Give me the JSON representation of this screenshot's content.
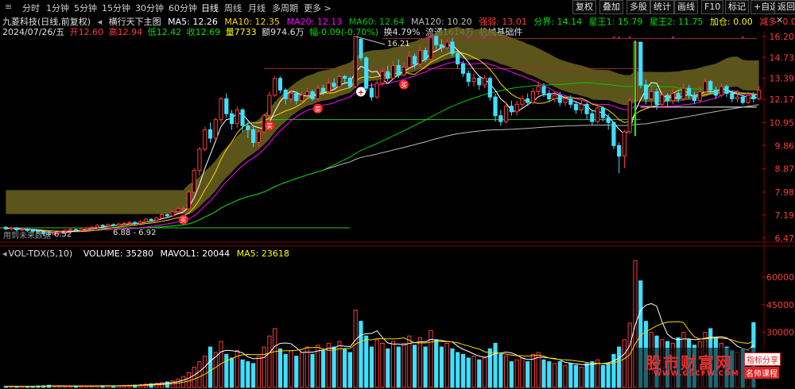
{
  "timeframe_tabs": [
    "分时",
    "1分钟",
    "5分钟",
    "15分钟",
    "30分钟",
    "60分钟",
    "日线",
    "周线",
    "月线",
    "多周期",
    "更多 >"
  ],
  "active_tab": "日线",
  "right_buttons": [
    "复权",
    "叠加",
    "多股",
    "统计",
    "画线",
    "F10",
    "标记",
    "+自选",
    "返回"
  ],
  "title_row": {
    "stock": "九菱科技(日线,前复权)",
    "indicator": "横行天下主图",
    "ma5": "MA5: 12.26",
    "ma10": "MA10: 12.35",
    "ma20": "MA20: 12.13",
    "ma60": "MA60: 12.64",
    "ma120": "MA120: 10.20",
    "qiangruo": "强弱: 13.01",
    "fenjie": "分界: 14.14",
    "wang1": "星王1: 15.79",
    "wang2": "星王2: 11.75",
    "jiacang": "加仓: 0.00",
    "jianduo": "减多: 0.00"
  },
  "info_row": {
    "date": "2024/07/26/五",
    "open": "开12.60",
    "high": "高12.94",
    "low": "低12.42",
    "close": "收12.69",
    "vol": "量7733",
    "amount": "额974.6万",
    "change": "幅-0.09(-0.70%)",
    "turnover": "换4.79%",
    "float": "流通1614万",
    "sector": "机械基础件"
  },
  "annotations": {
    "high_label": "16.21",
    "low_label1": "6.52",
    "low_label2": "6.88 - 6.92",
    "future_text": "用到未来数据"
  },
  "volume_header": {
    "name": "VOL-TDX(5,10)",
    "volume": "VOLUME: 35280",
    "mavol1": "MAVOL1: 20044",
    "ma5": "MA5: 23618"
  },
  "price_axis_labels": [
    "16.20",
    "14.73",
    "13.39",
    "12.17",
    "10.95",
    "9.86",
    "8.87",
    "7.98",
    "7.19",
    "6.47"
  ],
  "volume_axis_labels": [
    "60000",
    "45000",
    "30000"
  ],
  "watermark": {
    "site": "股市财富网",
    "url": "WWW.GSCFW.COM",
    "badge1": "指标分享",
    "badge2": "名师课程"
  },
  "colors": {
    "up": "#ff3a3a",
    "down": "#3ee0ff",
    "ma5": "#ffffff",
    "ma10": "#ffd700",
    "ma20": "#ff00ff",
    "ma60": "#00c800",
    "ma120": "#bbbbbb",
    "band": "#6b6320"
  },
  "chart_data": {
    "type": "candlestick",
    "price_range": [
      6.47,
      16.2
    ],
    "price_scale": "log",
    "dates_shown": [
      "2024/07/26"
    ],
    "candles": [
      [
        6.8,
        6.75,
        6.83,
        6.72
      ],
      [
        6.76,
        6.78,
        6.82,
        6.7
      ],
      [
        6.78,
        6.72,
        6.8,
        6.66
      ],
      [
        6.72,
        6.74,
        6.77,
        6.68
      ],
      [
        6.74,
        6.7,
        6.78,
        6.66
      ],
      [
        6.7,
        6.69,
        6.74,
        6.62
      ],
      [
        6.69,
        6.66,
        6.72,
        6.6
      ],
      [
        6.66,
        6.6,
        6.69,
        6.55
      ],
      [
        6.6,
        6.58,
        6.64,
        6.52
      ],
      [
        6.58,
        6.62,
        6.66,
        6.56
      ],
      [
        6.62,
        6.66,
        6.7,
        6.58
      ],
      [
        6.66,
        6.71,
        6.74,
        6.63
      ],
      [
        6.71,
        6.73,
        6.77,
        6.68
      ],
      [
        6.73,
        6.7,
        6.76,
        6.66
      ],
      [
        6.7,
        6.74,
        6.78,
        6.67
      ],
      [
        6.74,
        6.78,
        6.82,
        6.71
      ],
      [
        6.78,
        6.8,
        6.84,
        6.75
      ],
      [
        6.8,
        6.86,
        6.9,
        6.77
      ],
      [
        6.86,
        6.84,
        6.9,
        6.8
      ],
      [
        6.84,
        6.88,
        6.92,
        6.81
      ],
      [
        6.88,
        6.86,
        6.92,
        6.82
      ],
      [
        6.86,
        6.9,
        6.94,
        6.84
      ],
      [
        6.9,
        6.92,
        6.97,
        6.87
      ],
      [
        6.92,
        6.95,
        7.0,
        6.89
      ],
      [
        6.95,
        6.92,
        6.99,
        6.88
      ],
      [
        6.92,
        6.97,
        7.02,
        6.9
      ],
      [
        6.97,
        7.05,
        7.1,
        6.94
      ],
      [
        7.05,
        7.02,
        7.09,
        6.98
      ],
      [
        7.02,
        7.09,
        7.14,
        7.0
      ],
      [
        7.09,
        7.2,
        7.25,
        7.06
      ],
      [
        7.2,
        7.16,
        7.24,
        7.1
      ],
      [
        7.16,
        7.3,
        7.35,
        7.14
      ],
      [
        7.3,
        7.4,
        7.46,
        7.26
      ],
      [
        7.4,
        7.4,
        7.5,
        7.3
      ],
      [
        7.4,
        7.98,
        8.02,
        7.38
      ],
      [
        7.98,
        8.8,
        8.9,
        7.95
      ],
      [
        8.8,
        9.7,
        9.8,
        8.6
      ],
      [
        9.7,
        10.6,
        10.75,
        9.6
      ],
      [
        10.6,
        10.2,
        10.95,
        10.0
      ],
      [
        10.2,
        11.1,
        11.2,
        10.1
      ],
      [
        11.1,
        12.2,
        12.3,
        10.9
      ],
      [
        12.2,
        11.4,
        12.5,
        11.2
      ],
      [
        11.4,
        10.9,
        11.6,
        10.6
      ],
      [
        10.9,
        11.6,
        11.8,
        10.7
      ],
      [
        11.6,
        10.8,
        11.7,
        10.5
      ],
      [
        10.8,
        10.6,
        11.0,
        10.2
      ],
      [
        10.6,
        10.0,
        10.8,
        9.8
      ],
      [
        10.0,
        10.5,
        10.6,
        9.8
      ],
      [
        10.5,
        11.3,
        11.4,
        10.4
      ],
      [
        11.3,
        12.4,
        12.6,
        11.2
      ],
      [
        12.4,
        13.39,
        13.5,
        12.3
      ],
      [
        13.39,
        12.7,
        13.5,
        12.5
      ],
      [
        12.7,
        12.2,
        12.8,
        11.9
      ],
      [
        12.2,
        12.5,
        12.7,
        12.0
      ],
      [
        12.5,
        12.1,
        12.6,
        11.9
      ],
      [
        12.1,
        12.4,
        12.6,
        11.9
      ],
      [
        12.4,
        12.6,
        12.8,
        12.2
      ],
      [
        12.6,
        12.2,
        12.7,
        12.1
      ],
      [
        12.2,
        12.8,
        13.0,
        12.1
      ],
      [
        12.8,
        12.6,
        13.0,
        12.4
      ],
      [
        12.6,
        13.1,
        13.39,
        12.5
      ],
      [
        13.1,
        12.9,
        13.4,
        12.7
      ],
      [
        12.9,
        13.5,
        13.6,
        12.8
      ],
      [
        13.5,
        13.4,
        13.6,
        13.1
      ],
      [
        13.4,
        12.9,
        13.5,
        12.8
      ],
      [
        12.9,
        16.21,
        16.21,
        12.8
      ],
      [
        16.0,
        14.7,
        16.1,
        14.5
      ],
      [
        14.7,
        12.8,
        14.8,
        12.6
      ],
      [
        12.8,
        12.3,
        13.1,
        12.1
      ],
      [
        12.3,
        13.1,
        13.3,
        12.2
      ],
      [
        13.1,
        13.8,
        14.0,
        12.9
      ],
      [
        13.8,
        13.4,
        14.2,
        13.2
      ],
      [
        13.4,
        14.2,
        14.5,
        13.3
      ],
      [
        14.2,
        13.6,
        14.6,
        13.4
      ],
      [
        13.6,
        14.1,
        14.4,
        13.5
      ],
      [
        14.1,
        14.8,
        15.2,
        14.0
      ],
      [
        14.8,
        14.3,
        15.0,
        14.0
      ],
      [
        14.3,
        15.2,
        15.5,
        14.1
      ],
      [
        15.2,
        14.6,
        15.4,
        14.4
      ],
      [
        14.6,
        16.2,
        16.4,
        14.5
      ],
      [
        16.2,
        15.6,
        16.3,
        15.3
      ],
      [
        15.6,
        15.4,
        16.0,
        15.1
      ],
      [
        15.4,
        15.8,
        16.0,
        15.2
      ],
      [
        15.8,
        15.0,
        16.1,
        14.8
      ],
      [
        15.0,
        14.3,
        15.2,
        14.0
      ],
      [
        14.3,
        13.7,
        14.5,
        13.5
      ],
      [
        13.7,
        13.2,
        13.9,
        12.9
      ],
      [
        13.2,
        13.4,
        13.7,
        12.9
      ],
      [
        13.4,
        13.0,
        13.6,
        12.7
      ],
      [
        13.0,
        13.39,
        13.6,
        12.8
      ],
      [
        13.39,
        12.3,
        13.5,
        12.1
      ],
      [
        12.3,
        11.3,
        12.5,
        11.0
      ],
      [
        11.3,
        11.0,
        11.6,
        10.8
      ],
      [
        11.0,
        11.8,
        12.0,
        10.9
      ],
      [
        11.8,
        11.5,
        12.1,
        11.3
      ],
      [
        11.5,
        11.9,
        12.1,
        11.3
      ],
      [
        11.9,
        12.2,
        12.4,
        11.7
      ],
      [
        12.2,
        12.0,
        12.5,
        11.8
      ],
      [
        12.0,
        12.6,
        12.8,
        11.9
      ],
      [
        12.6,
        12.9,
        13.2,
        12.4
      ],
      [
        12.9,
        12.5,
        13.1,
        12.3
      ],
      [
        12.5,
        12.2,
        12.7,
        12.0
      ],
      [
        12.2,
        12.4,
        12.6,
        12.0
      ],
      [
        12.4,
        12.0,
        12.6,
        11.8
      ],
      [
        12.0,
        12.2,
        12.4,
        11.8
      ],
      [
        12.2,
        11.9,
        12.4,
        11.7
      ],
      [
        11.9,
        11.6,
        12.1,
        11.4
      ],
      [
        11.6,
        11.9,
        12.1,
        11.4
      ],
      [
        11.9,
        11.4,
        12.0,
        11.1
      ],
      [
        11.4,
        11.0,
        11.6,
        10.8
      ],
      [
        11.0,
        11.7,
        11.9,
        10.9
      ],
      [
        11.7,
        11.2,
        11.8,
        11.0
      ],
      [
        11.2,
        10.95,
        11.4,
        10.6
      ],
      [
        10.95,
        9.86,
        11.0,
        9.7
      ],
      [
        9.86,
        9.4,
        10.0,
        8.7
      ],
      [
        9.4,
        10.5,
        10.6,
        8.9
      ],
      [
        10.5,
        12.1,
        12.3,
        10.4
      ],
      [
        12.1,
        15.79,
        15.79,
        12.0
      ],
      [
        15.79,
        13.0,
        15.8,
        12.8
      ],
      [
        13.0,
        12.2,
        13.3,
        11.9
      ],
      [
        12.2,
        12.6,
        12.9,
        11.8
      ],
      [
        12.6,
        11.9,
        12.8,
        11.6
      ],
      [
        11.9,
        12.4,
        12.6,
        11.7
      ],
      [
        12.4,
        12.1,
        12.5,
        11.8
      ],
      [
        12.1,
        12.5,
        12.8,
        11.9
      ],
      [
        12.5,
        12.2,
        12.7,
        12.0
      ],
      [
        12.2,
        12.8,
        13.1,
        12.1
      ],
      [
        12.8,
        12.4,
        13.0,
        12.2
      ],
      [
        12.4,
        12.1,
        12.6,
        11.9
      ],
      [
        12.1,
        12.6,
        12.9,
        12.0
      ],
      [
        12.6,
        13.2,
        13.4,
        12.5
      ],
      [
        13.2,
        12.7,
        13.3,
        12.5
      ],
      [
        12.7,
        12.4,
        12.9,
        12.2
      ],
      [
        12.4,
        12.9,
        13.1,
        12.3
      ],
      [
        12.9,
        12.5,
        13.0,
        12.3
      ],
      [
        12.5,
        12.2,
        12.7,
        12.0
      ],
      [
        12.2,
        12.3,
        12.5,
        12.0
      ],
      [
        12.3,
        12.0,
        12.4,
        11.9
      ],
      [
        12.0,
        12.4,
        12.6,
        11.9
      ],
      [
        12.4,
        12.2,
        12.6,
        12.0
      ],
      [
        12.2,
        12.69,
        12.94,
        12.1
      ]
    ],
    "volumes": [
      600,
      700,
      500,
      650,
      600,
      550,
      800,
      900,
      1200,
      700,
      650,
      600,
      700,
      800,
      900,
      750,
      700,
      800,
      950,
      1000,
      900,
      850,
      1100,
      1200,
      1300,
      1500,
      1800,
      2000,
      2300,
      2600,
      3000,
      3600,
      4500,
      6000,
      8000,
      11000,
      14000,
      17000,
      22000,
      19000,
      25000,
      18000,
      16000,
      20000,
      15000,
      14000,
      13000,
      17000,
      22000,
      28000,
      32000,
      21000,
      18000,
      20000,
      17000,
      19000,
      22000,
      18000,
      23000,
      20000,
      24000,
      22000,
      25000,
      21000,
      19000,
      42000,
      36000,
      28000,
      22000,
      26000,
      24000,
      21000,
      25000,
      22000,
      24000,
      28000,
      23000,
      27000,
      22000,
      31000,
      26000,
      22000,
      24000,
      21000,
      19000,
      18000,
      16000,
      17000,
      15000,
      16000,
      21000,
      24000,
      18000,
      17000,
      14000,
      15000,
      16000,
      14000,
      18000,
      19000,
      15000,
      14000,
      13000,
      14000,
      12000,
      13000,
      12000,
      11000,
      13000,
      14000,
      15000,
      12000,
      13000,
      18000,
      22000,
      26000,
      35000,
      69000,
      58000,
      36000,
      30000,
      28000,
      26000,
      25000,
      24000,
      27000,
      30000,
      26000,
      23000,
      25000,
      30000,
      32000,
      27000,
      24000,
      22000,
      20000,
      19000,
      21000,
      20000,
      35280
    ]
  }
}
